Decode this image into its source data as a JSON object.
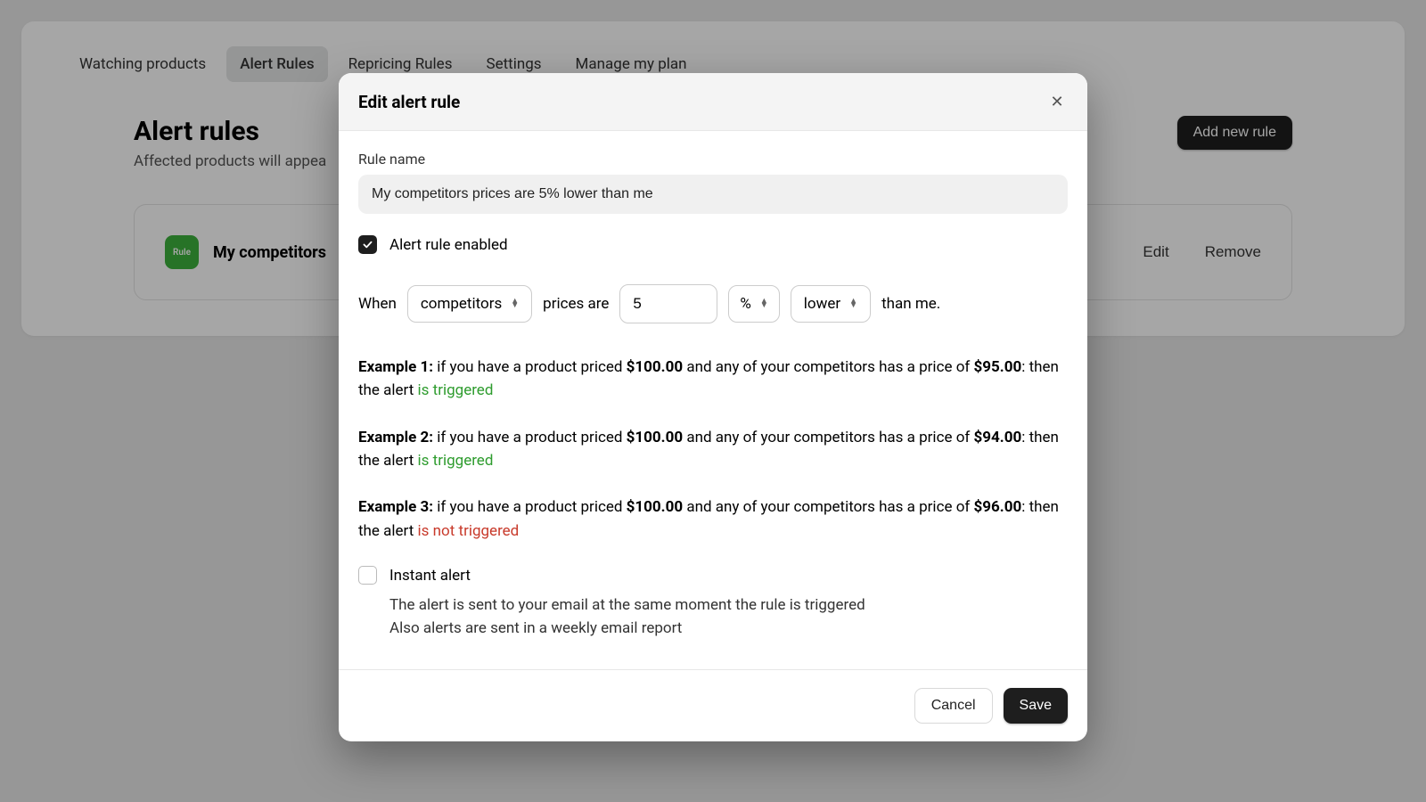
{
  "tabs": {
    "watching": "Watching products",
    "alert_rules": "Alert Rules",
    "repricing": "Repricing Rules",
    "settings": "Settings",
    "manage_plan": "Manage my plan"
  },
  "header": {
    "title": "Alert rules",
    "subtitle_visible": "Affected products will appea",
    "add_button": "Add new rule"
  },
  "rule_card": {
    "icon_text": "Rule",
    "name_visible": "My competitors",
    "edit": "Edit",
    "remove": "Remove"
  },
  "modal": {
    "title": "Edit alert rule",
    "rule_name_label": "Rule name",
    "rule_name_value": "My competitors prices are 5% lower than me",
    "enabled_label": "Alert rule enabled",
    "sentence": {
      "when": "When",
      "who": "competitors",
      "prices_are": "prices are",
      "threshold": "5",
      "unit": "%",
      "direction": "lower",
      "than_me": "than me."
    },
    "examples": {
      "e1_label": "Example 1:",
      "e1_a": " if you have a product priced ",
      "e1_price1": "$100.00",
      "e1_b": " and any of your competitors has a price of ",
      "e1_price2": "$95.00",
      "e1_c": ": then the alert ",
      "e1_result": "is triggered",
      "e2_label": "Example 2:",
      "e2_a": " if you have a product priced ",
      "e2_price1": "$100.00",
      "e2_b": " and any of your competitors has a price of ",
      "e2_price2": "$94.00",
      "e2_c": ": then the alert ",
      "e2_result": "is triggered",
      "e3_label": "Example 3:",
      "e3_a": " if you have a product priced ",
      "e3_price1": "$100.00",
      "e3_b": " and any of your competitors has a price of ",
      "e3_price2": "$96.00",
      "e3_c": ": then the alert ",
      "e3_result": "is not triggered"
    },
    "instant": {
      "label": "Instant alert",
      "desc1": "The alert is sent to your email at the same moment the rule is triggered",
      "desc2": "Also alerts are sent in a weekly email report"
    },
    "footer": {
      "cancel": "Cancel",
      "save": "Save"
    }
  }
}
